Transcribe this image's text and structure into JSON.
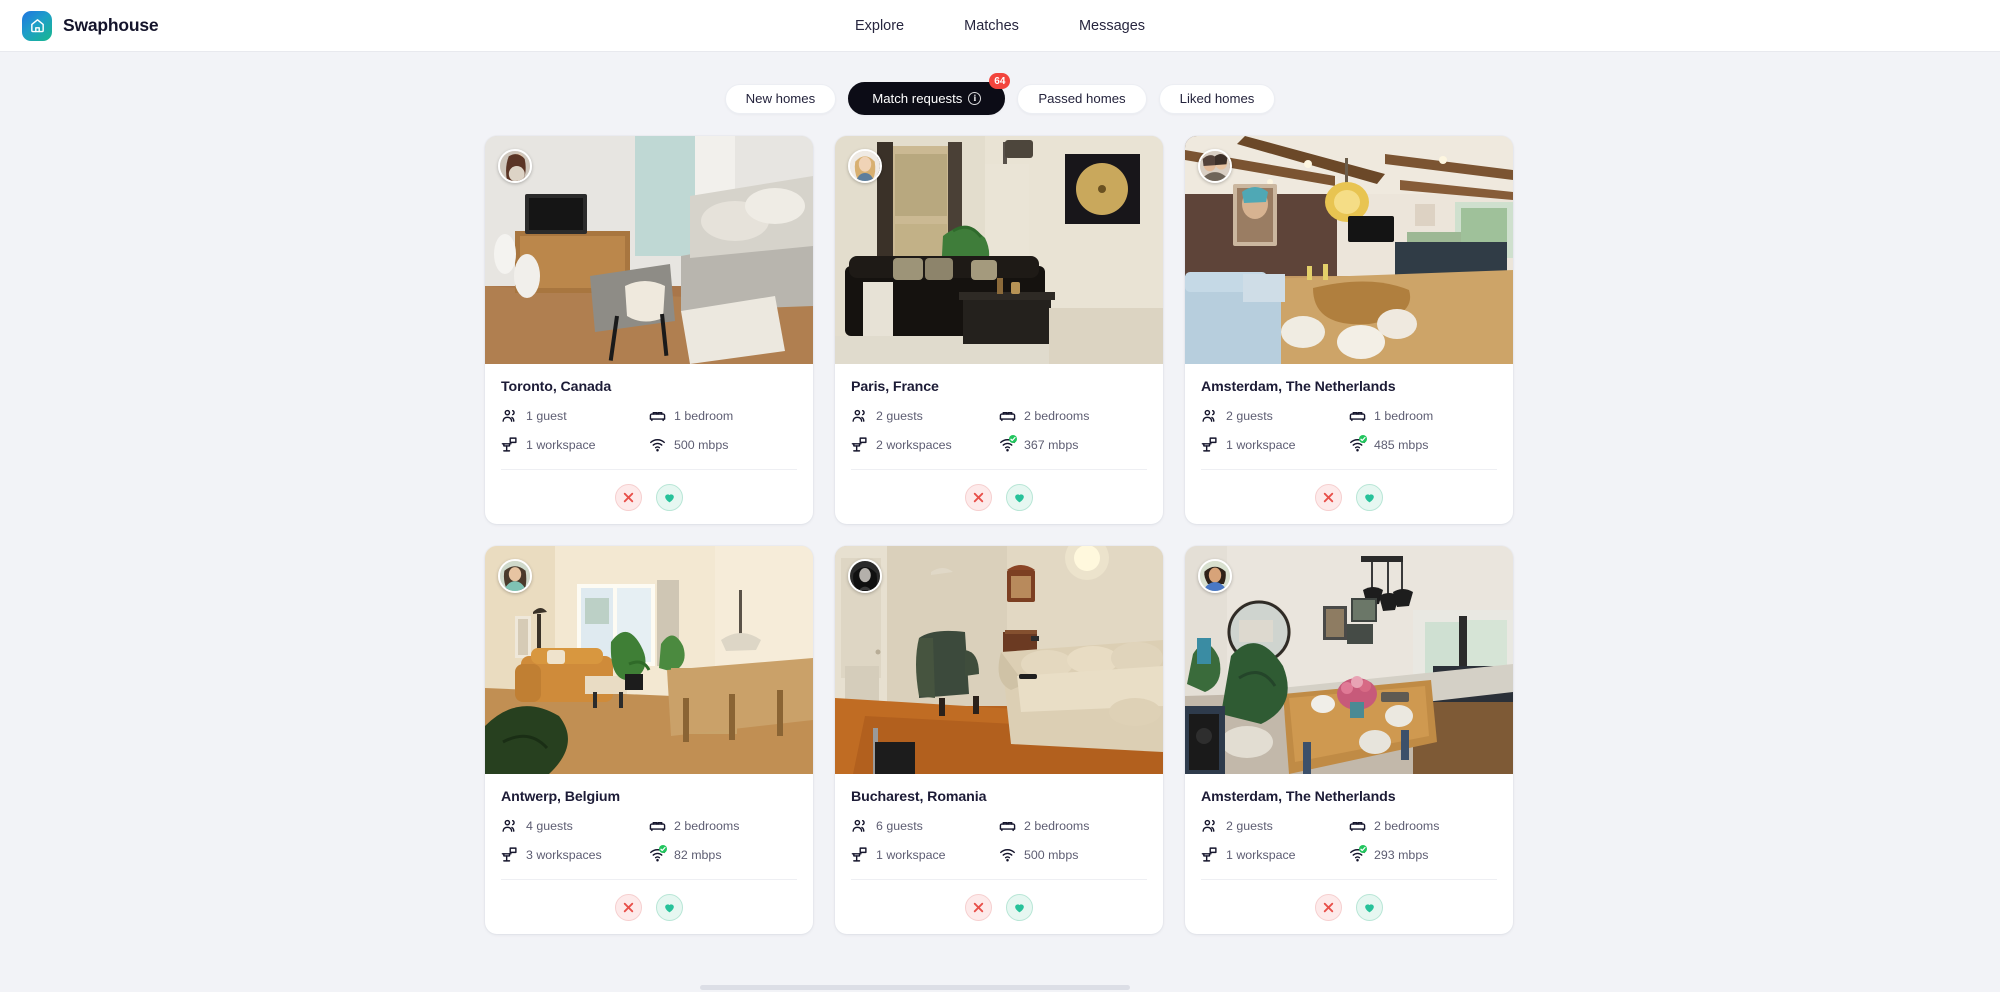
{
  "header": {
    "brand": "Swaphouse",
    "logo_icon": "house-icon",
    "nav": [
      {
        "label": "Explore",
        "name": "nav-explore"
      },
      {
        "label": "Matches",
        "name": "nav-matches"
      },
      {
        "label": "Messages",
        "name": "nav-messages"
      }
    ]
  },
  "filters": [
    {
      "label": "New homes",
      "active": false
    },
    {
      "label": "Match requests",
      "active": true,
      "info_icon": "info-icon",
      "badge": "64"
    },
    {
      "label": "Passed homes",
      "active": false
    },
    {
      "label": "Liked homes",
      "active": false
    }
  ],
  "colors": {
    "page_bg": "#f2f3f7",
    "card_bg": "#ffffff",
    "active_pill": "#0c0c16",
    "badge_red": "#f2453d",
    "pass_red": "#e8504a",
    "like_green": "#27c29a",
    "verified_green": "#22c55e",
    "title_navy": "#1c1b36"
  },
  "icons": {
    "guests": "guests-icon",
    "bedrooms": "bed-icon",
    "workspaces": "workspace-icon",
    "wifi": "wifi-icon",
    "pass": "close-icon",
    "like": "heart-icon"
  },
  "cards": [
    {
      "title": "Toronto, Canada",
      "guests": "1 guest",
      "bedrooms": "1 bedroom",
      "workspaces": "1 workspace",
      "speed": "500 mbps",
      "wifi_verified": false
    },
    {
      "title": "Paris, France",
      "guests": "2 guests",
      "bedrooms": "2 bedrooms",
      "workspaces": "2 workspaces",
      "speed": "367 mbps",
      "wifi_verified": true
    },
    {
      "title": "Amsterdam, The Netherlands",
      "guests": "2 guests",
      "bedrooms": "1 bedroom",
      "workspaces": "1 workspace",
      "speed": "485 mbps",
      "wifi_verified": true
    },
    {
      "title": "Antwerp, Belgium",
      "guests": "4 guests",
      "bedrooms": "2 bedrooms",
      "workspaces": "3 workspaces",
      "speed": "82 mbps",
      "wifi_verified": true
    },
    {
      "title": "Bucharest, Romania",
      "guests": "6 guests",
      "bedrooms": "2 bedrooms",
      "workspaces": "1 workspace",
      "speed": "500 mbps",
      "wifi_verified": false
    },
    {
      "title": "Amsterdam, The Netherlands",
      "guests": "2 guests",
      "bedrooms": "2 bedrooms",
      "workspaces": "1 workspace",
      "speed": "293 mbps",
      "wifi_verified": true
    }
  ]
}
